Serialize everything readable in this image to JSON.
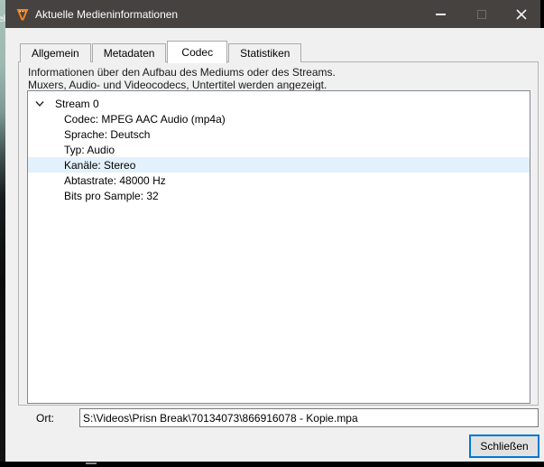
{
  "window": {
    "title": "Aktuelle Medieninformationen",
    "edge_label": "el"
  },
  "tabs": [
    {
      "label": "Allgemein",
      "selected": false
    },
    {
      "label": "Metadaten",
      "selected": false
    },
    {
      "label": "Codec",
      "selected": true
    },
    {
      "label": "Statistiken",
      "selected": false
    }
  ],
  "codec_page": {
    "description_line1": "Informationen über den Aufbau des Mediums oder des Streams.",
    "description_line2": "Muxers, Audio- und Videocodecs, Untertitel werden angezeigt.",
    "tree": {
      "root": "Stream 0",
      "expanded": true,
      "children": [
        "Codec: MPEG AAC Audio (mp4a)",
        "Sprache: Deutsch",
        "Typ: Audio",
        "Kanäle: Stereo",
        "Abtastrate: 48000 Hz",
        "Bits pro Sample: 32"
      ],
      "highlighted_item": "Kanäle: Stereo"
    }
  },
  "location": {
    "label": "Ort:",
    "value": "S:\\Videos\\Prisn Break\\70134073\\866916078 - Kopie.mpa"
  },
  "footer": {
    "close_button": "Schließen"
  },
  "colors": {
    "titlebar": "#454240",
    "accent_orange": "#f5821f",
    "selection": "#e2f1fb",
    "default_button_border": "#0078d7"
  }
}
